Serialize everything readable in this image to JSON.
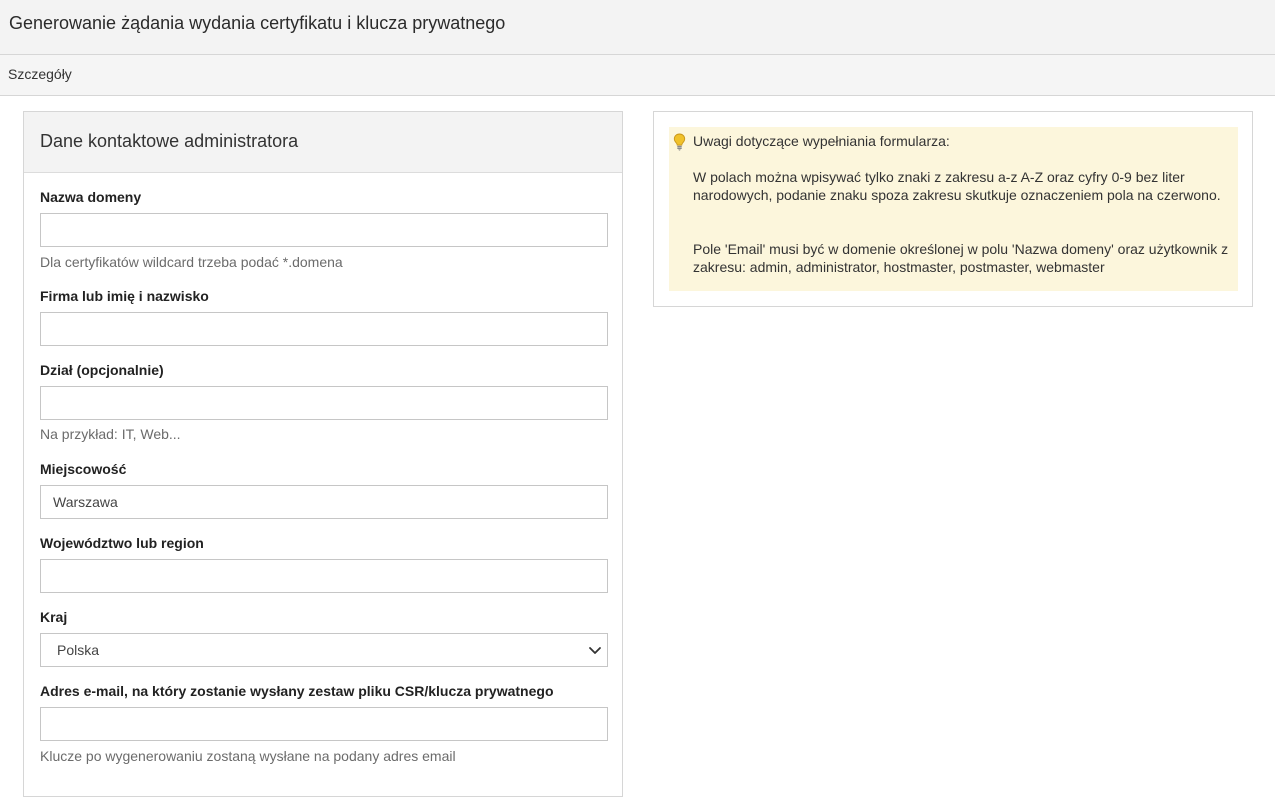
{
  "header": {
    "title": "Generowanie żądania wydania certyfikatu i klucza prywatnego"
  },
  "subnav": {
    "tab_label": "Szczegóły"
  },
  "form": {
    "title": "Dane kontaktowe administratora",
    "domain": {
      "label": "Nazwa domeny",
      "value": "",
      "hint": "Dla certyfikatów wildcard trzeba podać *.domena"
    },
    "company": {
      "label": "Firma lub imię i nazwisko",
      "value": ""
    },
    "department": {
      "label": "Dział (opcjonalnie)",
      "value": "",
      "hint": "Na przykład: IT, Web..."
    },
    "city": {
      "label": "Miejscowość",
      "value": "Warszawa"
    },
    "region": {
      "label": "Województwo lub region",
      "value": ""
    },
    "country": {
      "label": "Kraj",
      "selected": "Polska"
    },
    "email": {
      "label": "Adres e-mail, na który zostanie wysłany zestaw pliku CSR/klucza prywatnego",
      "value": "",
      "hint": "Klucze po wygenerowaniu zostaną wysłane na podany adres email"
    }
  },
  "info": {
    "icon": "lightbulb-icon",
    "title": "Uwagi dotyczące wypełniania formularza:",
    "paragraph1": "W polach można wpisywać tylko znaki z zakresu a-z A-Z oraz cyfry 0-9 bez liter narodowych, podanie znaku spoza zakresu skutkuje oznaczeniem pola na czerwono.",
    "paragraph2": "Pole 'Email' musi być w domenie określonej w polu 'Nazwa domeny' oraz użytkownik z zakresu: admin, administrator, hostmaster, postmaster, webmaster"
  },
  "colors": {
    "info_bg": "#fcf6dc",
    "bulb": "#f0c12a",
    "header_bg": "#f3f3f3",
    "border": "#d6d6d6"
  }
}
